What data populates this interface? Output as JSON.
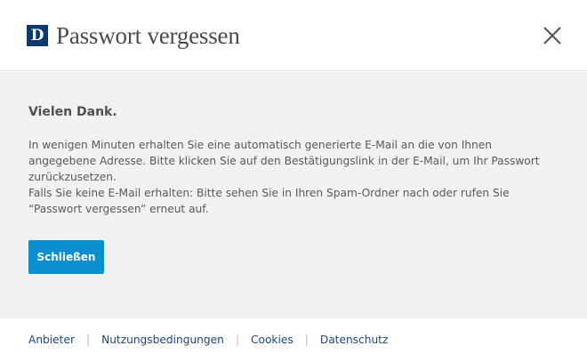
{
  "header": {
    "logo_letter": "D",
    "title": "Passwort vergessen",
    "close_icon": "close-icon",
    "brand_color": "#0d3a6b"
  },
  "content": {
    "heading": "Vielen Dank.",
    "paragraph_1": "In wenigen Minuten erhalten Sie eine automatisch generierte E-Mail an die von Ihnen angegebene Adresse. Bitte klicken Sie auf den Bestätigungslink in der E-Mail, um Ihr Passwort zurückzusetzen.",
    "paragraph_2": "Falls Sie keine E-Mail erhalten: Bitte sehen Sie in Ihren Spam-Ordner nach oder rufen Sie “Passwort vergessen” erneut auf.",
    "close_button_label": "Schließen",
    "button_color": "#0a8fd0"
  },
  "footer": {
    "links": [
      "Anbieter",
      "Nutzungsbedingungen",
      "Cookies",
      "Datenschutz"
    ],
    "separator": "|",
    "link_color": "#1d4877"
  }
}
